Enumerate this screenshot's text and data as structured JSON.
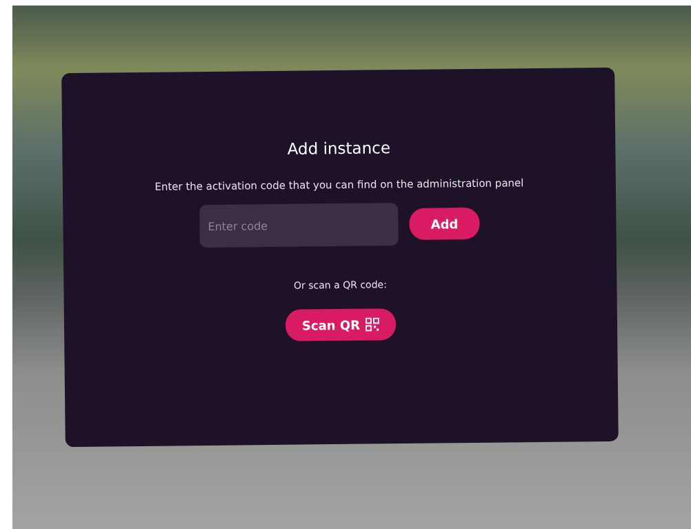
{
  "dialog": {
    "title": "Add instance",
    "instructions": "Enter the activation code that you can find on the administration panel",
    "code_field": {
      "placeholder": "Enter code"
    },
    "add_button": "Add",
    "scan_prompt": "Or scan a QR code:",
    "scan_button": "Scan QR"
  }
}
